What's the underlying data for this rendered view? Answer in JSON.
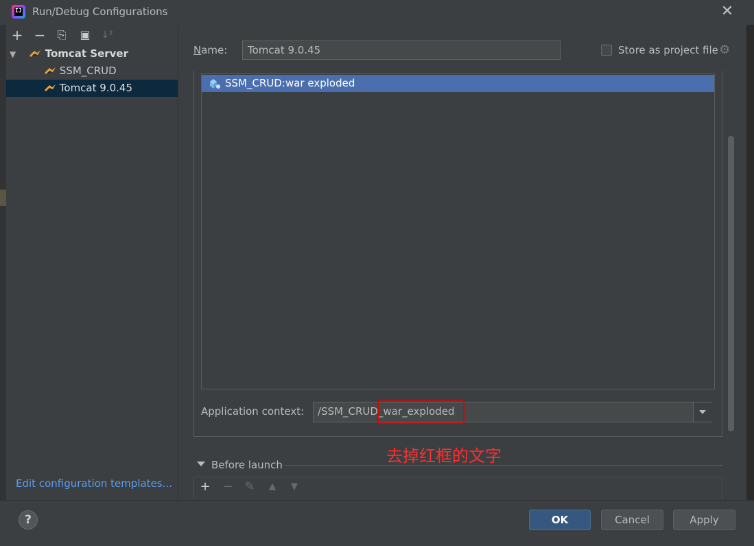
{
  "window": {
    "title": "Run/Debug Configurations",
    "close_glyph": "✕"
  },
  "left": {
    "toolbar": [
      "+",
      "−",
      "⎘",
      "▣",
      "↓²"
    ],
    "tree_root": "Tomcat Server",
    "items": [
      {
        "label": "SSM_CRUD",
        "selected": false
      },
      {
        "label": "Tomcat 9.0.45",
        "selected": true
      }
    ],
    "edit_templates": "Edit configuration templates..."
  },
  "form": {
    "name_label": "Name:",
    "name_value": "Tomcat 9.0.45",
    "store_label": "Store as project file",
    "deploy_item": "SSM_CRUD:war exploded",
    "context_label": "Application context:",
    "context_value": "/SSM_CRUD_war_exploded"
  },
  "annotation": {
    "text": "去掉红框的文字",
    "color": "#ff2d2d"
  },
  "before_launch": {
    "label": "Before launch",
    "icons": [
      "+",
      "−",
      "✎",
      "▲",
      "▼"
    ]
  },
  "footer": {
    "help": "?",
    "ok": "OK",
    "cancel": "Cancel",
    "apply": "Apply"
  },
  "colors": {
    "selection": "#4b6eaf",
    "accent_ok": "#365880",
    "link": "#589df6",
    "red_box": "#e30000"
  },
  "icons": {
    "app": "intellij-logo-icon",
    "tomcat": "tomcat-icon",
    "deploy": "artifact-icon",
    "gear": "gear-icon"
  }
}
